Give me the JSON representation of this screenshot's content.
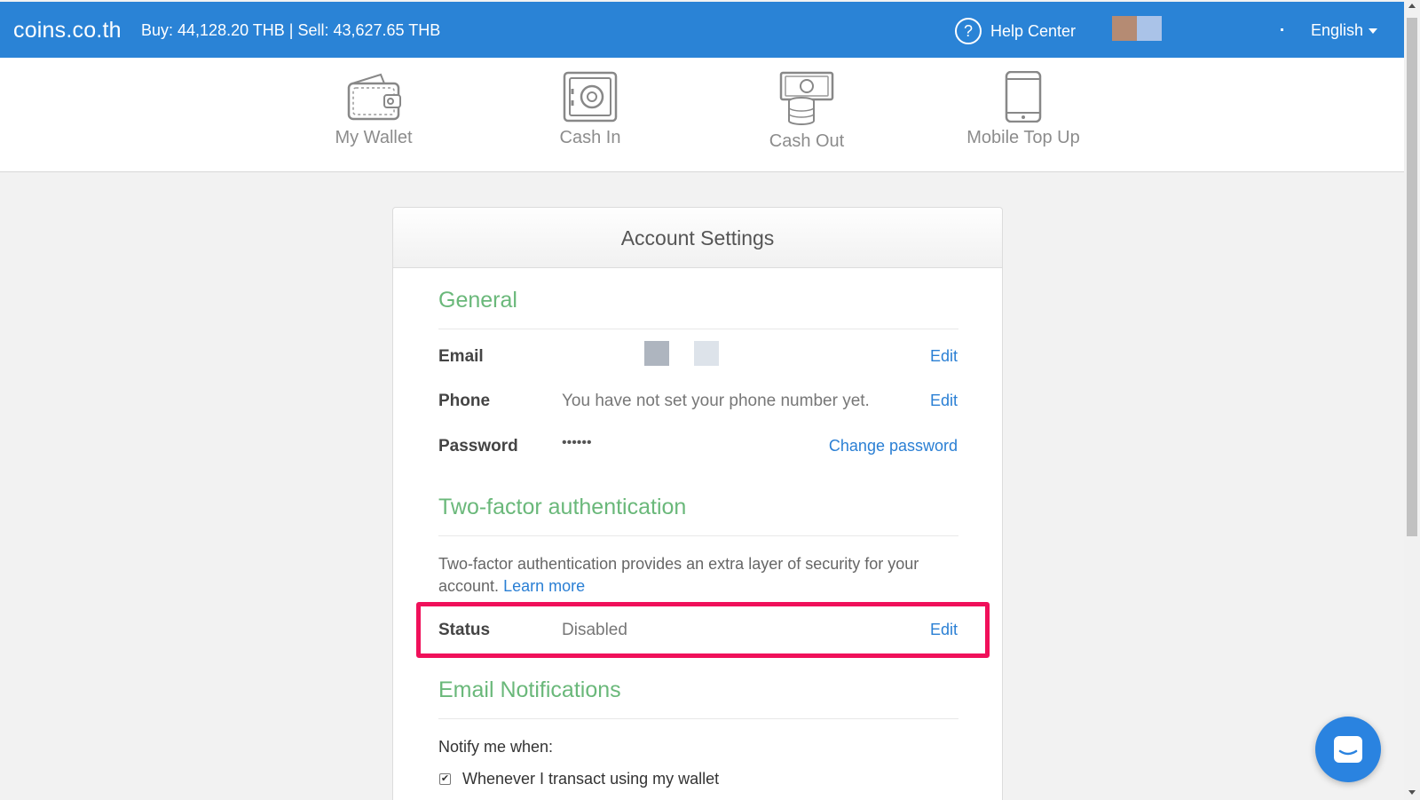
{
  "header": {
    "brand": "coins.co.th",
    "rates": "Buy: 44,128.20 THB | Sell: 43,627.65 THB",
    "help_label": "Help Center",
    "help_icon": "question-circle-icon",
    "language": "English"
  },
  "nav": {
    "items": [
      {
        "label": "My Wallet",
        "icon": "wallet-icon"
      },
      {
        "label": "Cash In",
        "icon": "safe-icon"
      },
      {
        "label": "Cash Out",
        "icon": "cash-coins-icon"
      },
      {
        "label": "Mobile Top Up",
        "icon": "mobile-phone-icon"
      }
    ]
  },
  "card": {
    "title": "Account Settings",
    "general": {
      "title": "General",
      "email_label": "Email",
      "email_edit": "Edit",
      "phone_label": "Phone",
      "phone_value": "You have not set your phone number yet.",
      "phone_edit": "Edit",
      "password_label": "Password",
      "password_value": "••••••",
      "password_link": "Change password"
    },
    "twofa": {
      "title": "Two-factor authentication",
      "description": "Two-factor authentication provides an extra layer of security for your account.",
      "learn_more": "Learn more",
      "status_label": "Status",
      "status_value": "Disabled",
      "status_edit": "Edit"
    },
    "notifications": {
      "title": "Email Notifications",
      "intro": "Notify me when:",
      "options": [
        {
          "label": "Whenever I transact using my wallet",
          "checked": true
        }
      ]
    }
  },
  "colors": {
    "header_bg": "#2a83d6",
    "section_title": "#6ab87a",
    "link": "#2a7fd4",
    "highlight": "#f0105a"
  }
}
